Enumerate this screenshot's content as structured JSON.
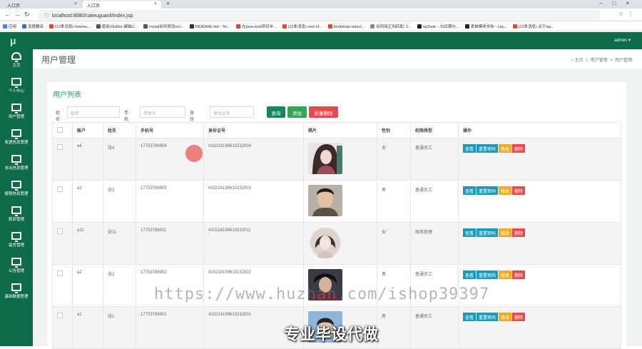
{
  "browser": {
    "tabs": [
      {
        "label": "入口页"
      },
      {
        "label": "入口页"
      }
    ],
    "url": "localhost:8080/caiwuguanli/index.jsp",
    "bookmarks": [
      {
        "label": "应用",
        "color": "#4285f4"
      },
      {
        "label": "百度翻译",
        "color": "#2f6fdf"
      },
      {
        "label": "(12条消息) freema...",
        "color": "#e34a27"
      },
      {
        "label": "使用UEditor 编辑C...",
        "color": "#555555"
      },
      {
        "label": "mysql如何修改roo...",
        "color": "#555555"
      },
      {
        "label": "README.md - Ter...",
        "color": "#333333"
      },
      {
        "label": "在java web项目中...",
        "color": "#e34a27"
      },
      {
        "label": "(12条消息) root of...",
        "color": "#e34a27"
      },
      {
        "label": "bootstrap-select...",
        "color": "#e34a27"
      },
      {
        "label": "如何用正则匹配: 2...",
        "color": "#888888"
      },
      {
        "label": "layDate - JS日期与...",
        "color": "#222222"
      },
      {
        "label": "表单模块文档 - Lay...",
        "color": "#222222"
      },
      {
        "label": "(12条消息) 关于lay...",
        "color": "#e34a27"
      }
    ]
  },
  "app": {
    "logo": "μ",
    "user": "admin ▾",
    "sidebar": [
      {
        "label": "主页"
      },
      {
        "label": "个人中心"
      },
      {
        "label": "用户管理"
      },
      {
        "label": "收透信息管理"
      },
      {
        "label": "支出信息管理"
      },
      {
        "label": "报销信息管理"
      },
      {
        "label": "薪资管理"
      },
      {
        "label": "留言管理"
      },
      {
        "label": "公告管理"
      },
      {
        "label": "基础数据管理"
      }
    ],
    "page_title": "用户管理",
    "breadcrumb": {
      "home": "主页",
      "sep": ">",
      "level1": "用户管理",
      "level2": "用户管理"
    },
    "panel_title": "用户列表",
    "search": {
      "name_label": "姓名",
      "name_placeholder": "姓名",
      "phone_label": "手机号",
      "phone_placeholder": "手机号",
      "id_label": "身份证号",
      "id_placeholder": "身份证号",
      "query_btn": "查询",
      "add_btn": "添加",
      "batch_delete_btn": "批量删除"
    },
    "table": {
      "headers": [
        "账户",
        "姓名",
        "手机号",
        "身份证号",
        "照片",
        "性别",
        "权限类型",
        "操作"
      ],
      "ops": {
        "view": "查看",
        "reset": "重置密码",
        "edit": "修改",
        "delete": "删除"
      },
      "rows": [
        {
          "account": "a4",
          "name": "张4",
          "phone": "17703786904",
          "idcard": "410224199610232004",
          "gender": "女",
          "role": "普通员工"
        },
        {
          "account": "a3",
          "name": "张3",
          "phone": "17703786903",
          "idcard": "410224199610232003",
          "gender": "男",
          "role": "普通员工"
        },
        {
          "account": "a11",
          "name": "张11",
          "phone": "17703786911",
          "idcard": "410224199610232011",
          "gender": "女",
          "role": "财务经理"
        },
        {
          "account": "a2",
          "name": "张2",
          "phone": "17703786902",
          "idcard": "410224199610232002",
          "gender": "男",
          "role": "普通员工"
        },
        {
          "account": "a1",
          "name": "张1",
          "phone": "17703786901",
          "idcard": "410224199610232001",
          "gender": "男",
          "role": "普通员工"
        }
      ]
    }
  },
  "overlay": {
    "watermark": "https://www.huzhan.com/ishop39397",
    "caption": "专业毕设代做"
  }
}
